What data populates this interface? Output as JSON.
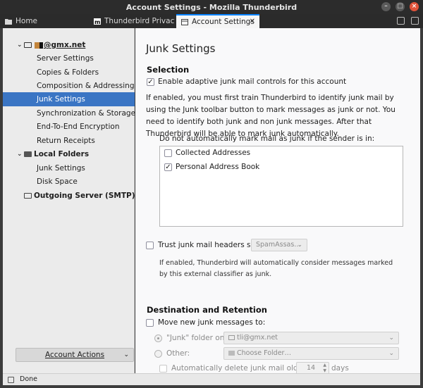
{
  "window": {
    "title": "Account Settings - Mozilla Thunderbird",
    "buttons": [
      "minimize",
      "maximize",
      "close"
    ]
  },
  "tabs": [
    {
      "label": "Home",
      "icon": "folder-icon",
      "active": false
    },
    {
      "label": "Thunderbird Privacy N",
      "icon": "m-logo-icon",
      "active": false
    },
    {
      "label": "Account Settings",
      "icon": "settings-tab-icon",
      "active": true
    }
  ],
  "sidebar": {
    "account": {
      "label": "@gmx.net",
      "icon": "mail-icon"
    },
    "account_items": [
      "Server Settings",
      "Copies & Folders",
      "Composition & Addressing",
      "Junk Settings",
      "Synchronization & Storage",
      "End-To-End Encryption",
      "Return Receipts"
    ],
    "selected_item": "Junk Settings",
    "local_folders": {
      "label": "Local Folders",
      "items": [
        "Junk Settings",
        "Disk Space"
      ]
    },
    "outgoing": {
      "label": "Outgoing Server (SMTP)"
    },
    "account_actions": "Account Actions"
  },
  "main": {
    "title": "Junk Settings",
    "selection": {
      "heading": "Selection",
      "enable_adaptive": {
        "label": "Enable adaptive junk mail controls for this account",
        "checked": true
      },
      "description": "If enabled, you must first train Thunderbird to identify junk mail by using the Junk toolbar button to mark messages as junk or not. You need to identify both junk and non junk messages. After that Thunderbird will be able to mark junk automatically.",
      "whitelist_label": "Do not automatically mark mail as junk if the sender is in:",
      "address_books": [
        {
          "name": "Collected Addresses",
          "checked": false
        },
        {
          "name": "Personal Address Book",
          "checked": true
        }
      ],
      "trust_headers": {
        "label": "Trust junk mail headers set by:",
        "checked": false,
        "value": "SpamAssas…"
      },
      "trust_note": "If enabled, Thunderbird will automatically consider messages marked by this external classifier as junk."
    },
    "destination": {
      "heading": "Destination and Retention",
      "move_junk": {
        "label": "Move new junk messages to:",
        "checked": false
      },
      "junk_folder_option": {
        "label": "\"Junk\" folder on:",
        "value": "tli@gmx.net",
        "selected": true
      },
      "other_option": {
        "label": "Other:",
        "value": "Choose Folder…",
        "selected": false
      },
      "auto_delete": {
        "label": "Automatically delete junk mail older than",
        "days": "14",
        "unit": "days",
        "checked": false
      }
    }
  },
  "status": {
    "text": "Done"
  }
}
